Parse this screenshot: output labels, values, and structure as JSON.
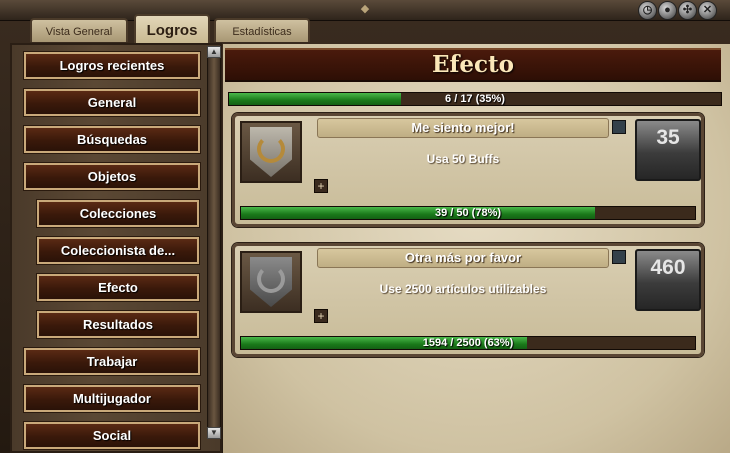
{
  "window": {
    "controls": [
      "clock-icon",
      "globe-icon",
      "settings-icon",
      "close-icon"
    ]
  },
  "tabs": [
    {
      "label": "Vista General",
      "active": false
    },
    {
      "label": "Logros",
      "active": true
    },
    {
      "label": "Estadísticas",
      "active": false
    }
  ],
  "sidebar": {
    "items": [
      {
        "label": "Logros recientes"
      },
      {
        "label": "General"
      },
      {
        "label": "Búsquedas"
      },
      {
        "label": "Objetos"
      },
      {
        "label": "Colecciones"
      },
      {
        "label": "Coleccionista de..."
      },
      {
        "label": "Efecto"
      },
      {
        "label": "Resultados"
      },
      {
        "label": "Trabajar"
      },
      {
        "label": "Multijugador"
      },
      {
        "label": "Social"
      }
    ]
  },
  "main": {
    "title": "Efecto",
    "overall_progress": {
      "text": "6 / 17 (35%)",
      "fraction": 0.35
    },
    "achievements": [
      {
        "title": "Me siento mejor!",
        "description": "Usa 50 Buffs",
        "points": "35",
        "progress_text": "39 / 50 (78%)",
        "progress_fraction": 0.78,
        "medal_color": "#b58a3a"
      },
      {
        "title": "Otra más por favor",
        "description": "Use 2500 artículos utilizables",
        "points": "460",
        "progress_text": "1594 / 2500 (63%)",
        "progress_fraction": 0.63,
        "medal_color": "#9a9a9a"
      }
    ]
  },
  "colors": {
    "accent_green": "#2a9a2a",
    "title_text": "#fbe7b8",
    "nav_border": "#c9a97a"
  }
}
